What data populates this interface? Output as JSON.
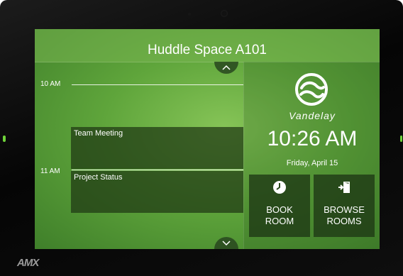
{
  "device": {
    "brand": "AMX"
  },
  "header": {
    "title": "Huddle Space A101"
  },
  "calendar": {
    "times": [
      "10 AM",
      "11 AM"
    ],
    "events": [
      {
        "title": "Team Meeting"
      },
      {
        "title": "Project Status"
      }
    ],
    "scroll_up_icon": "chevron-up-icon",
    "scroll_down_icon": "chevron-down-icon"
  },
  "info": {
    "brand_name": "Vandelay",
    "time": "10:26 AM",
    "date": "Friday, April 15"
  },
  "actions": {
    "book_label": "BOOK\nROOM",
    "book_icon": "clock-icon",
    "browse_label": "BROWSE\nROOMS",
    "browse_icon": "door-enter-icon"
  },
  "colors": {
    "screen_green": "#5fa53b",
    "panel_dark": "#1e3714",
    "text": "#ffffff"
  }
}
